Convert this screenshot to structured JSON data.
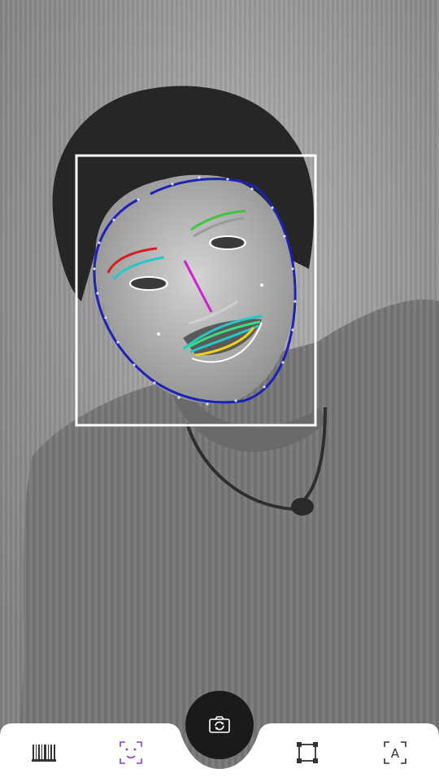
{
  "overlay": {
    "text_label": "A",
    "colors": {
      "face_box": "#ffffff",
      "contour": "#1a22b8",
      "left_brow": "#d21f1f",
      "right_brow": "#3cc83c",
      "nose": "#d21fd2",
      "eye": "#ffffff",
      "lip_top": "#22c9c9",
      "lip_mid": "#39e07a",
      "lip_bottom": "#f2d21a"
    }
  },
  "toolbar": {
    "tabs": [
      {
        "icon": "barcode-icon",
        "active": false
      },
      {
        "icon": "face-detect-icon",
        "active": true
      },
      {
        "icon": "object-crop-icon",
        "active": false
      },
      {
        "icon": "text-recognition-icon",
        "active": false
      }
    ],
    "capture_icon": "camera-switch-icon",
    "accent": "#8a3fd0"
  }
}
